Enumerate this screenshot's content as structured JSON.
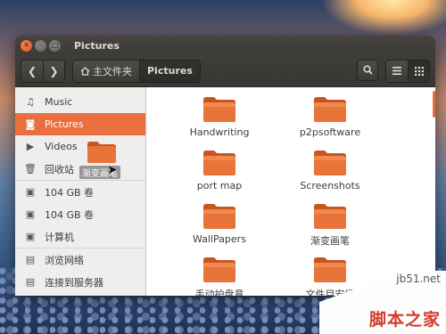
{
  "window": {
    "title": "Pictures"
  },
  "toolbar": {
    "back_glyph": "❮",
    "forward_glyph": "❯",
    "breadcrumb": [
      {
        "label": "主文件夹",
        "icon": "home-icon"
      },
      {
        "label": "Pictures"
      }
    ],
    "search_glyph": "⚲",
    "list_view_glyph": "☰",
    "grid_view_glyph": "⁝⁝⁝"
  },
  "sidebar": {
    "items": [
      {
        "label": "Music",
        "icon": "music-icon",
        "glyph": "♫"
      },
      {
        "label": "Pictures",
        "icon": "camera-icon",
        "glyph": "◙",
        "selected": true
      },
      {
        "label": "Videos",
        "icon": "video-icon",
        "glyph": "▶"
      },
      {
        "label": "回收站",
        "icon": "trash-icon",
        "glyph": "🗑"
      },
      {
        "label": "104 GB 卷",
        "icon": "drive-icon",
        "glyph": "▣"
      },
      {
        "label": "104 GB 卷",
        "icon": "drive-icon",
        "glyph": "▣"
      },
      {
        "label": "计算机",
        "icon": "computer-icon",
        "glyph": "▣"
      },
      {
        "label": "浏览网络",
        "icon": "network-icon",
        "glyph": "▤"
      },
      {
        "label": "连接到服务器",
        "icon": "server-icon",
        "glyph": "▤"
      }
    ],
    "drag_label": "渐变画笔"
  },
  "files": [
    "Handwriting",
    "p2psoftware",
    "port map",
    "Screenshots",
    "WallPapers",
    "渐变画笔",
    "手动护盘意",
    "文件目安场"
  ],
  "colors": {
    "accent": "#e9703e",
    "folder": "#e06a2e",
    "titlebar": "#3c3b37"
  },
  "watermark": {
    "site": "jb51.net",
    "brand": "脚本之家"
  }
}
